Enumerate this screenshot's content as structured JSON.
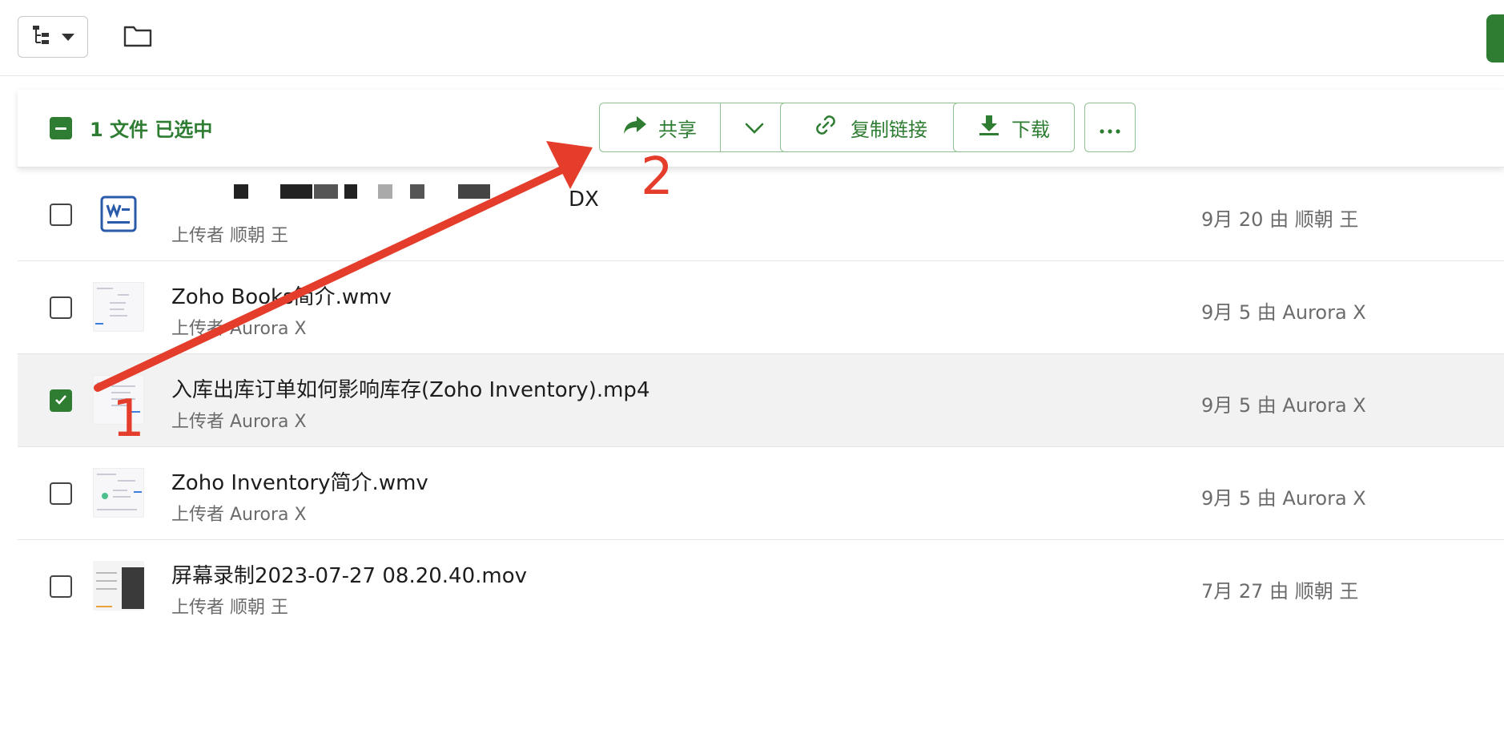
{
  "toolbar": {
    "tree_icon": "tree-view-icon",
    "folder_icon": "folder-icon"
  },
  "selection": {
    "count_text": "1 文件 已选中",
    "share_label": "共享",
    "copy_link_label": "复制链接",
    "download_label": "下载"
  },
  "files": [
    {
      "name": "DX",
      "uploader": "上传者 顺朝 王",
      "meta": "9月 20 由 顺朝 王",
      "checked": false,
      "thumb": "document-icon"
    },
    {
      "name": "Zoho Books简介.wmv",
      "uploader": "上传者 Aurora X",
      "meta": "9月 5 由 Aurora X",
      "checked": false,
      "thumb": "video-thumbnail"
    },
    {
      "name": "入库出库订单如何影响库存(Zoho Inventory).mp4",
      "uploader": "上传者 Aurora X",
      "meta": "9月 5 由 Aurora X",
      "checked": true,
      "thumb": "video-thumbnail"
    },
    {
      "name": "Zoho Inventory简介.wmv",
      "uploader": "上传者 Aurora X",
      "meta": "9月 5 由 Aurora X",
      "checked": false,
      "thumb": "video-thumbnail"
    },
    {
      "name": "屏幕录制2023-07-27 08.20.40.mov",
      "uploader": "上传者 顺朝 王",
      "meta": "7月 27 由 顺朝 王",
      "checked": false,
      "thumb": "video-thumbnail"
    }
  ],
  "annotations": {
    "step1": "1",
    "step2": "2"
  },
  "colors": {
    "accent": "#2e7d32",
    "annotation": "#e53d2b"
  }
}
